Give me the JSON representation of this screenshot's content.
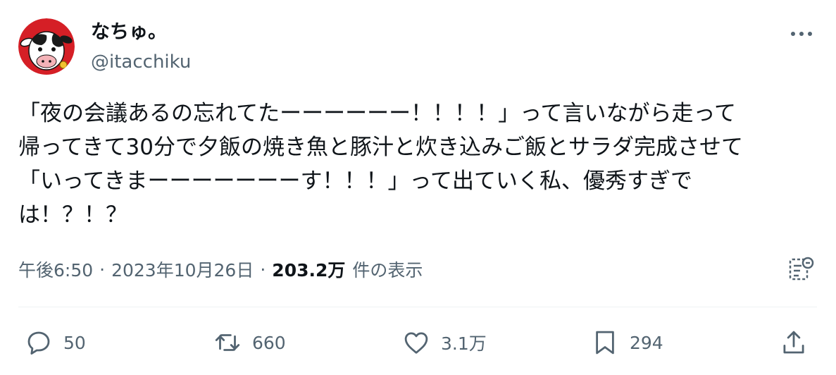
{
  "author": {
    "display_name": "なちゅ。",
    "handle": "@itacchiku"
  },
  "tweet": {
    "lines": [
      "「夜の会議あるの忘れてたーーーーーー！！！！」って言いながら走って",
      "帰ってきて30分で夕飯の焼き魚と豚汁と炊き込みご飯とサラダ完成させて",
      "「いってきまーーーーーーーす！！！」って出ていく私、優秀すぎで",
      "は！？！？"
    ]
  },
  "meta": {
    "time": "午後6:50",
    "separator": "·",
    "date": "2023年10月26日",
    "views_count": "203.2万",
    "views_label": "件の表示"
  },
  "actions": {
    "reply_count": "50",
    "retweet_count": "660",
    "like_count": "3.1万",
    "bookmark_count": "294"
  },
  "icons": {
    "avatar": "cow-avatar",
    "more": "more-horizontal-icon",
    "analytics": "analytics-icon",
    "reply": "reply-icon",
    "retweet": "retweet-icon",
    "like": "heart-icon",
    "bookmark": "bookmark-icon",
    "share": "share-icon"
  },
  "colors": {
    "text_primary": "#0f1419",
    "text_secondary": "#536471",
    "avatar_background": "#d51f26",
    "divider": "#eff3f4"
  }
}
